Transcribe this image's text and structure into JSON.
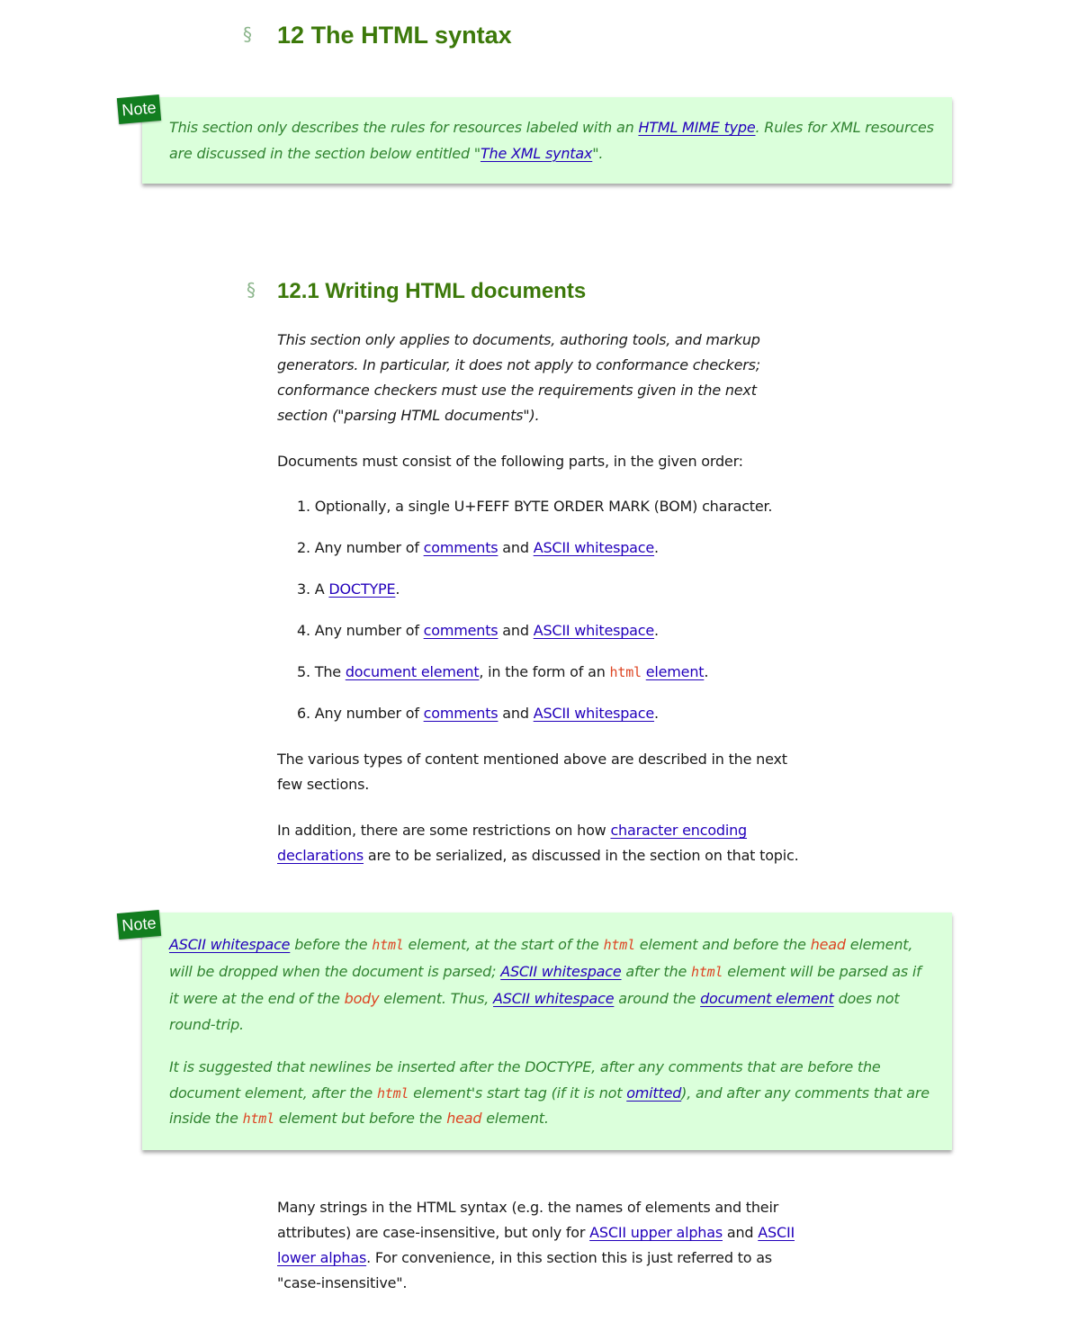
{
  "heading_main": {
    "section_sign": "§",
    "number": "12",
    "title": "The HTML syntax"
  },
  "note1": {
    "tag": "Note",
    "t1": "This section only describes the rules for resources labeled with an ",
    "link_mime": "HTML MIME type",
    "t2": ". Rules for XML resources are discussed in the section below entitled \"",
    "link_xml": "The XML syntax",
    "t3": "\"."
  },
  "heading_sub": {
    "section_sign": "§",
    "number": "12.1",
    "title": "Writing HTML documents"
  },
  "intro_italic": "This section only applies to documents, authoring tools, and markup generators. In particular, it does not apply to conformance checkers; conformance checkers must use the requirements given in the next section (\"parsing HTML documents\").",
  "parts_intro": "Documents must consist of the following parts, in the given order:",
  "parts": {
    "p1": {
      "num": "1.",
      "text": "Optionally, a single U+FEFF BYTE ORDER MARK (BOM) character."
    },
    "p2": {
      "num": "2.",
      "pre": "Any number of ",
      "link1": "comments",
      "mid": " and ",
      "link2": "ASCII whitespace",
      "post": "."
    },
    "p3": {
      "num": "3.",
      "pre": "A ",
      "link1": "DOCTYPE",
      "post": "."
    },
    "p4": {
      "num": "4.",
      "pre": "Any number of ",
      "link1": "comments",
      "mid": " and ",
      "link2": "ASCII whitespace",
      "post": "."
    },
    "p5": {
      "num": "5.",
      "pre": "The ",
      "link1": "document element",
      "mid": ", in the form of an ",
      "code": "html",
      "link2": "element",
      "post": "."
    },
    "p6": {
      "num": "6.",
      "pre": "Any number of ",
      "link1": "comments",
      "mid": " and ",
      "link2": "ASCII whitespace",
      "post": "."
    }
  },
  "content_types": "The various types of content mentioned above are described in the next few sections.",
  "encoding": {
    "pre": "In addition, there are some restrictions on how ",
    "link": "character encoding declarations",
    "post": " are to be serialized, as discussed in the section on that topic."
  },
  "note2": {
    "tag": "Note",
    "para1": {
      "link_ws1": "ASCII whitespace",
      "t1": " before the ",
      "code_html1": "html",
      "t2": " element, at the start of the ",
      "code_html2": "html",
      "t3": " element and before the ",
      "word_head": "head",
      "t4": " element, will be dropped when the document is parsed; ",
      "link_ws2": "ASCII whitespace",
      "t5": " after the ",
      "code_html3": "html",
      "t6": " element will be parsed as if it were at the end of the ",
      "word_body": "body",
      "t7": " element. Thus, ",
      "link_ws3": "ASCII whitespace",
      "t8": " around the ",
      "link_docel": "document element",
      "t9": " does not round-trip."
    },
    "para2": {
      "t1": "It is suggested that newlines be inserted after the DOCTYPE, after any comments that are before the document element, after the ",
      "code_html1": "html",
      "t2": " element's start tag (if it is not ",
      "link_omitted": "omitted",
      "t3": "), and after any comments that are inside the ",
      "code_html2": "html",
      "t4": " element but before the ",
      "word_head": "head",
      "t5": " element."
    }
  },
  "case": {
    "t1": "Many strings in the HTML syntax (e.g. the names of elements and their attributes) are case-insensitive, but only for ",
    "link_upper": "ASCII upper alphas",
    "t2": " and ",
    "link_lower": "ASCII lower alphas",
    "t3": ". For convenience, in this section this is just referred to as \"case-insensitive\"."
  },
  "colors": {
    "heading": "#3c790a",
    "note_background": "#dbffdb",
    "note_tag": "#127d1f",
    "note_text": "#308330",
    "link": "#2200bb",
    "code": "#dd4422"
  }
}
